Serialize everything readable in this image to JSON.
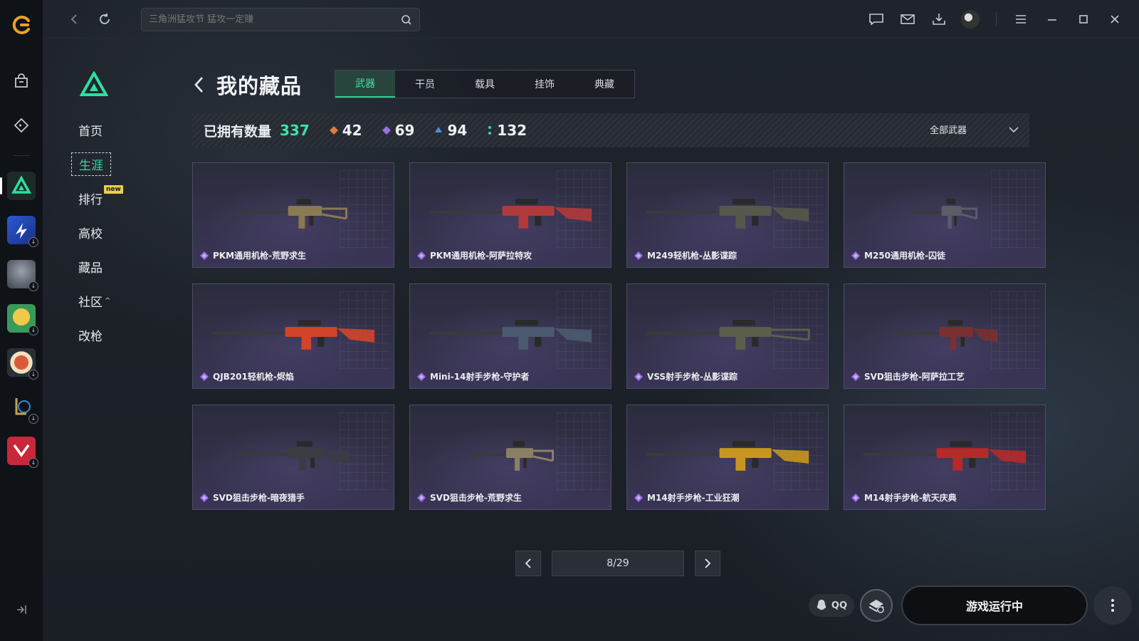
{
  "search": {
    "placeholder": "三角洲猛攻节 猛攻一定赚"
  },
  "subnav": {
    "items": [
      {
        "label": "首页"
      },
      {
        "label": "生涯"
      },
      {
        "label": "排行",
        "badge": "new"
      },
      {
        "label": "高校"
      },
      {
        "label": "藏品"
      },
      {
        "label": "社区"
      },
      {
        "label": "改枪"
      }
    ]
  },
  "header": {
    "title": "我的藏品"
  },
  "tabs": [
    {
      "label": "武器"
    },
    {
      "label": "干员"
    },
    {
      "label": "载具"
    },
    {
      "label": "挂饰"
    },
    {
      "label": "典藏"
    }
  ],
  "stats": {
    "owned_label": "已拥有数量",
    "total": "337",
    "tiers": [
      {
        "count": "42",
        "color": "#e07a3a"
      },
      {
        "count": "69",
        "color": "#9a6ee8"
      },
      {
        "count": "94",
        "color": "#4a8fe0"
      },
      {
        "count": "132",
        "color": "#3ad6a0"
      }
    ],
    "filter": "全部武器"
  },
  "items": [
    {
      "name": "PKM通用机枪-荒野求生",
      "skin": "#8a7a52"
    },
    {
      "name": "PKM通用机枪-阿萨拉特攻",
      "skin": "#b03a3a"
    },
    {
      "name": "M249轻机枪-丛影谍踪",
      "skin": "#55584a"
    },
    {
      "name": "M250通用机枪-囚徒",
      "skin": "#5a5d66"
    },
    {
      "name": "QJB201轻机枪-烬焰",
      "skin": "#d2452a"
    },
    {
      "name": "Mini-14射手步枪-守护者",
      "skin": "#4b5a70"
    },
    {
      "name": "VSS射手步枪-丛影谍踪",
      "skin": "#5c5e4c"
    },
    {
      "name": "SVD狙击步枪-阿萨拉工艺",
      "skin": "#7a3030"
    },
    {
      "name": "SVD狙击步枪-暗夜猎手",
      "skin": "#3a3c44"
    },
    {
      "name": "SVD狙击步枪-荒野求生",
      "skin": "#8a8066"
    },
    {
      "name": "M14射手步枪-工业狂潮",
      "skin": "#c8961e"
    },
    {
      "name": "M14射手步枪-航天庆典",
      "skin": "#b52a2a"
    }
  ],
  "pager": {
    "text": "8/29"
  },
  "bottom": {
    "qq": "QQ",
    "run": "游戏运行中"
  },
  "colors": {
    "accent": "#3ee2a4",
    "gem": "#9a6ee8"
  }
}
